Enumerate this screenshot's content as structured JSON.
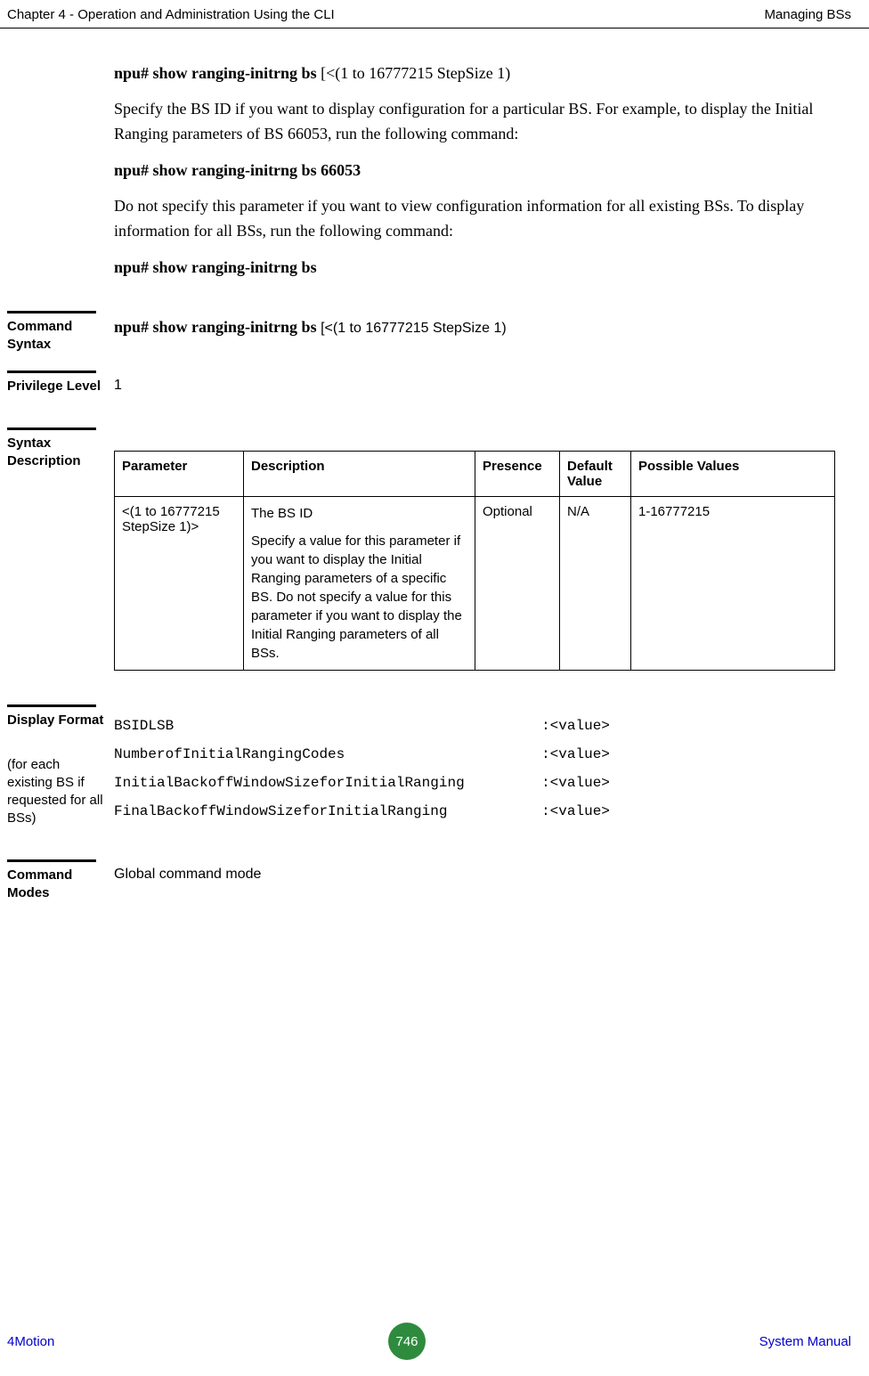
{
  "header": {
    "left": "Chapter 4 - Operation and Administration Using the CLI",
    "right": "Managing BSs"
  },
  "intro": {
    "cmd1_bold": "npu# show ranging-initrng bs ",
    "cmd1_param": "[<(1 to 16777215 StepSize 1)",
    "para1": "Specify the BS ID if you want to display configuration for a particular BS. For example, to display the Initial Ranging parameters of BS 66053, run the following command:",
    "cmd2": "npu# show ranging-initrng bs 66053",
    "para2": "Do not specify this parameter if you want to view configuration information for all existing BSs. To display information for all BSs, run the following command:",
    "cmd3": "npu# show ranging-initrng bs"
  },
  "command_syntax": {
    "label": "Command Syntax",
    "cmd_bold": "npu# show ranging-initrng bs ",
    "cmd_param": "[<(1 to 16777215 StepSize 1)"
  },
  "privilege": {
    "label": "Privilege Level",
    "value": "1"
  },
  "syntax_desc": {
    "label": "Syntax Description",
    "headers": {
      "parameter": "Parameter",
      "description": "Description",
      "presence": "Presence",
      "default": "Default Value",
      "possible": "Possible Values"
    },
    "row": {
      "parameter": "<(1 to 16777215 StepSize 1)>",
      "desc_line1": "The BS ID",
      "desc_line2": "Specify a value for this parameter if you want to display the Initial Ranging parameters of a specific BS. Do not specify a value for this parameter if you want to display the Initial Ranging parameters of all BSs.",
      "presence": "Optional",
      "default": "N/A",
      "possible": "1-16777215"
    }
  },
  "display_format": {
    "label": "Display Format",
    "sublabel": "(for each existing BS if requested for all BSs)",
    "lines": "BSIDLSB                                           :<value>\nNumberofInitialRangingCodes                       :<value>\nInitialBackoffWindowSizeforInitialRanging         :<value>\nFinalBackoffWindowSizeforInitialRanging           :<value>"
  },
  "command_modes": {
    "label": "Command Modes",
    "value": "Global command mode"
  },
  "footer": {
    "left": "4Motion",
    "page": "746",
    "right": "System Manual"
  }
}
